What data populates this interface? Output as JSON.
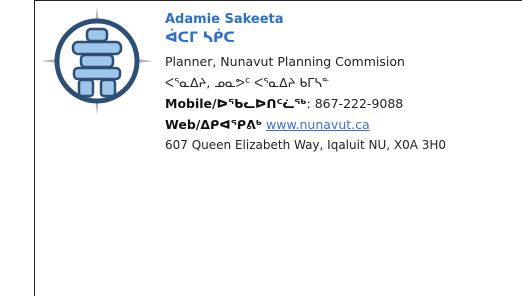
{
  "signature": {
    "name": "Adamie Sakeeta",
    "name_syllabics": "ᐋᑕᒥ ᓴᑮᑕ",
    "title_english": "Planner, Nunavut Planning Commision",
    "title_syllabics": "ᐸᕐᓇᐃᔨ, ᓄᓇᕗᑦ ᐸᕐᓇᐃᔨ ᑲᒥᓴᓐ",
    "mobile_label": "Mobile/ᐅᖃᓚᐅᑎᑦᓛᖅ",
    "mobile_value": ": 867-222-9088",
    "web_label": "Web/ᐃᑭᐊᕿᕕᒃ",
    "web_link": "www.nunavut.ca",
    "address": "607 Queen Elizabeth Way, Iqaluit NU, X0A 3H0"
  },
  "colors": {
    "accent": "#2f6fc4",
    "link": "#3b74c9",
    "logo_ring": "#2c4f73",
    "logo_stone": "#9ec6ea",
    "logo_compass": "#b5b5b5"
  }
}
